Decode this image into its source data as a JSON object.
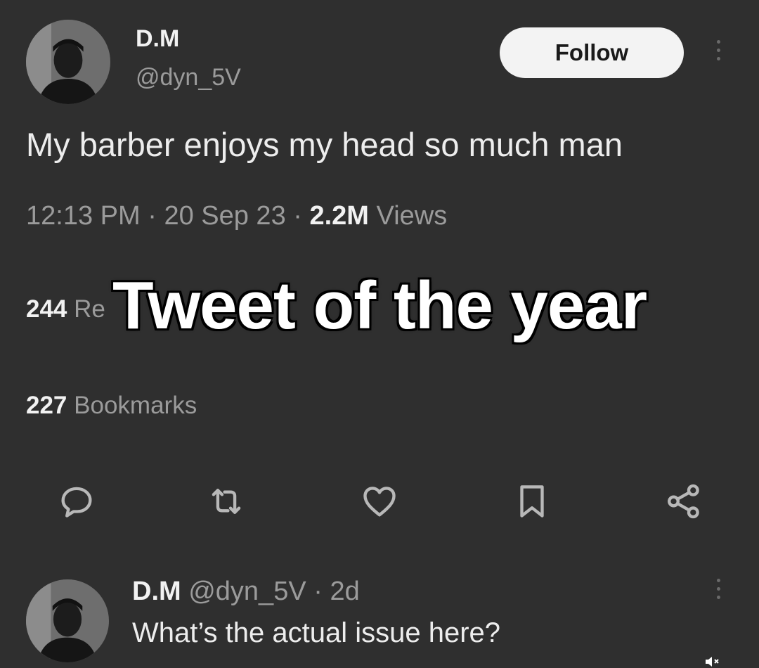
{
  "tweet": {
    "author_name": "D.M",
    "author_handle": "@dyn_5V",
    "follow_label": "Follow",
    "text": "My barber enjoys my head so much man",
    "time": "12:13 PM",
    "date": "20 Sep 23",
    "views_count": "2.2M",
    "views_label": "Views",
    "reposts_count": "244",
    "reposts_label": "Re",
    "bookmarks_count": "227",
    "bookmarks_label": "Bookmarks"
  },
  "caption": {
    "text": "Tweet of the year"
  },
  "actions": {
    "icons": [
      "reply-icon",
      "retweet-icon",
      "like-icon",
      "bookmark-icon",
      "share-icon"
    ]
  },
  "reply": {
    "author_name": "D.M",
    "author_handle": "@dyn_5V",
    "age": "2d",
    "text": "What’s the actual issue here?"
  },
  "colors": {
    "background": "#2f2f2f",
    "text_primary": "#f2f2f2",
    "text_secondary": "#9b9b9b",
    "follow_bg": "#f3f3f3"
  }
}
